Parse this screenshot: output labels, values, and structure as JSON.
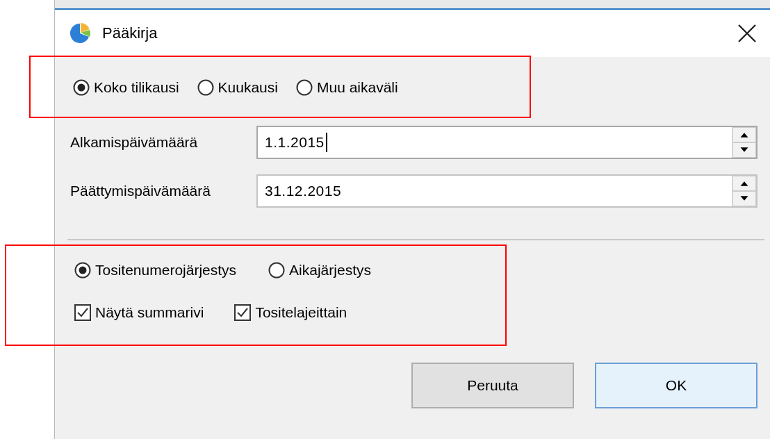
{
  "window": {
    "title": "Pääkirja"
  },
  "period": {
    "highlighted": true,
    "options": [
      {
        "label": "Koko tilikausi",
        "selected": true
      },
      {
        "label": "Kuukausi",
        "selected": false
      },
      {
        "label": "Muu aikaväli",
        "selected": false
      }
    ]
  },
  "fields": [
    {
      "label": "Alkamispäivämäärä",
      "value": "1.1.2015",
      "focused": true
    },
    {
      "label": "Päättymispäivämäärä",
      "value": "31.12.2015",
      "focused": false
    }
  ],
  "options_group": {
    "highlighted": true,
    "sort_options": [
      {
        "label": "Tositenumerojärjestys",
        "selected": true
      },
      {
        "label": "Aikajärjestys",
        "selected": false
      }
    ],
    "checkboxes": [
      {
        "label": "Näytä summarivi",
        "checked": true
      },
      {
        "label": "Tositelajeittain",
        "checked": true
      }
    ]
  },
  "buttons": [
    {
      "label": "Peruuta",
      "default": false
    },
    {
      "label": "OK",
      "default": true
    }
  ]
}
